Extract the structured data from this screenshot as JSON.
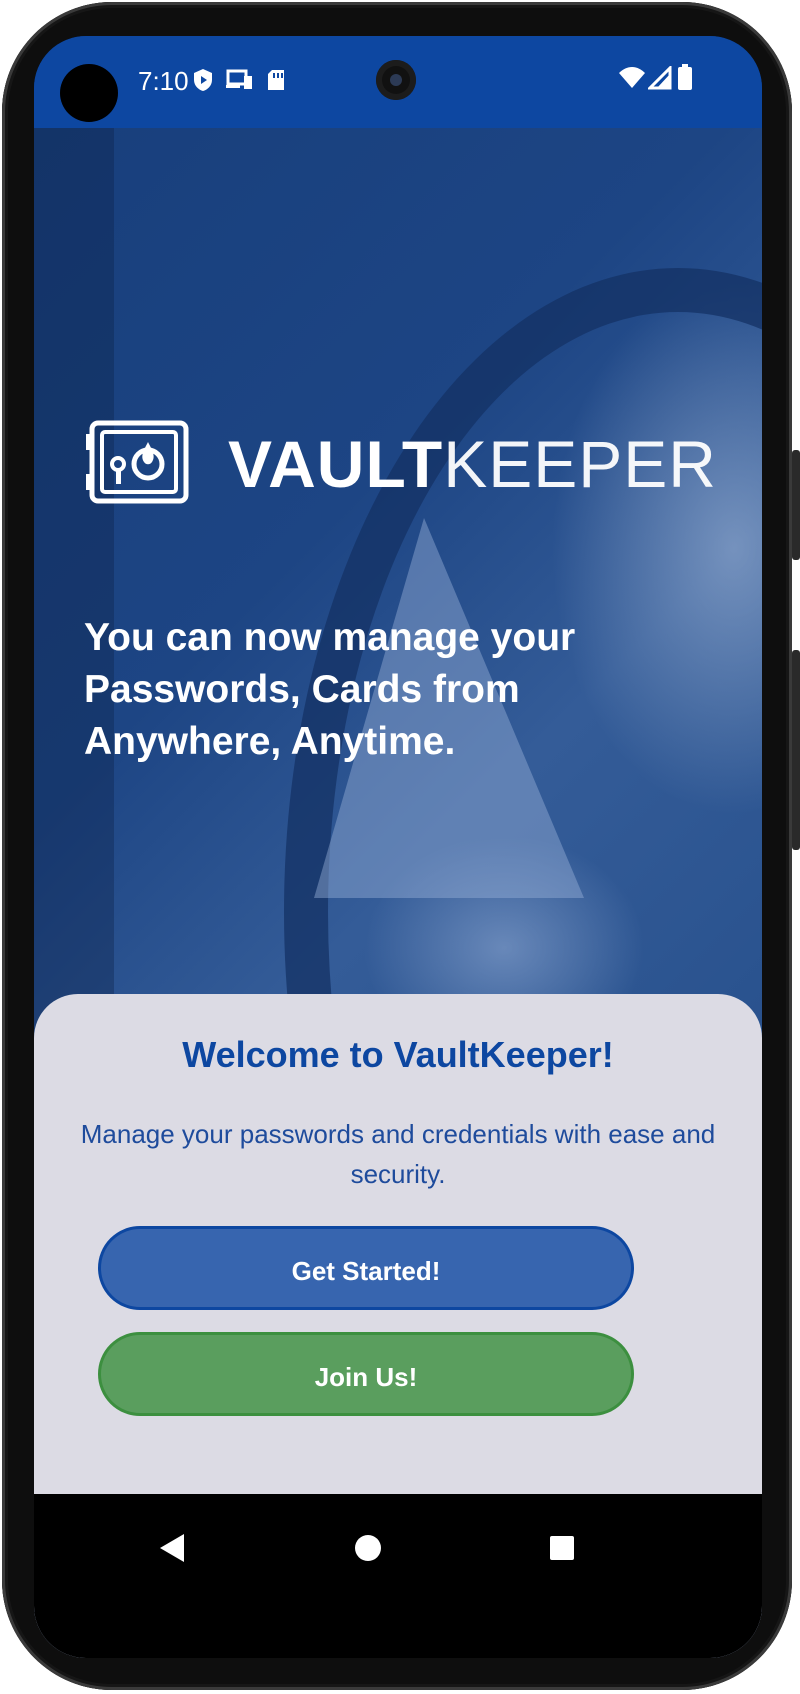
{
  "status_bar": {
    "time": "7:10",
    "icons": [
      "shield-icon",
      "cast-icon",
      "sd-card-icon",
      "wifi-icon",
      "cellular-icon",
      "battery-icon"
    ]
  },
  "brand": {
    "name_bold": "VAULT",
    "name_light": "KEEPER",
    "logo_icon": "vault-safe-icon"
  },
  "hero": {
    "tagline": "You can now manage your Passwords, Cards from Anywhere, Anytime."
  },
  "welcome": {
    "title": "Welcome to VaultKeeper!",
    "subtitle": "Manage your passwords and credentials with ease and security.",
    "primary_button": "Get Started!",
    "secondary_button": "Join Us!"
  },
  "nav_bar": {
    "icons": [
      "back-icon",
      "home-icon",
      "recents-icon"
    ]
  },
  "colors": {
    "status_bar": "#0d47a1",
    "primary": "#3765af",
    "secondary": "#5a9e5e",
    "sheet": "#dcdbe4",
    "title_text": "#0d47a1"
  }
}
